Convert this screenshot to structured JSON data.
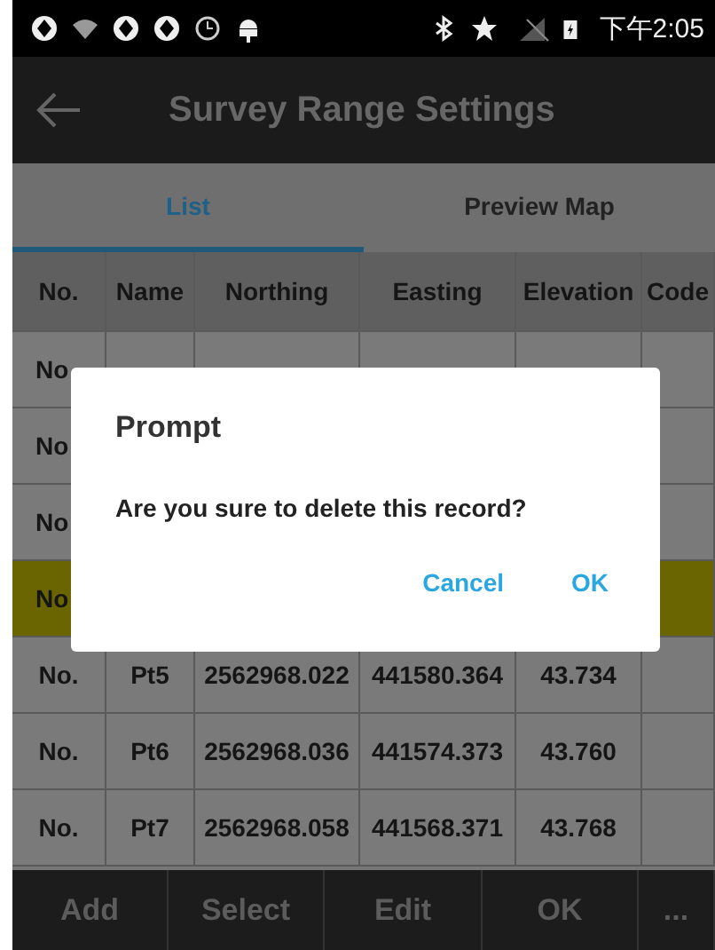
{
  "status_bar": {
    "time": "下午2:05"
  },
  "app_bar": {
    "title": "Survey Range Settings"
  },
  "tabs": [
    {
      "label": "List",
      "selected": true
    },
    {
      "label": "Preview Map",
      "selected": false
    }
  ],
  "table": {
    "columns": [
      "No.",
      "Name",
      "Northing",
      "Easting",
      "Elevation",
      "Code"
    ],
    "rows": [
      {
        "selected": false,
        "cells": [
          "No"
        ]
      },
      {
        "selected": false,
        "cells": [
          "No"
        ]
      },
      {
        "selected": false,
        "cells": [
          "No"
        ]
      },
      {
        "selected": true,
        "cells": [
          "No"
        ]
      },
      {
        "selected": false,
        "cells": [
          "No.",
          "Pt5",
          "2562968.022",
          "441580.364",
          "43.734"
        ]
      },
      {
        "selected": false,
        "cells": [
          "No.",
          "Pt6",
          "2562968.036",
          "441574.373",
          "43.760"
        ]
      },
      {
        "selected": false,
        "cells": [
          "No.",
          "Pt7",
          "2562968.058",
          "441568.371",
          "43.768"
        ]
      }
    ]
  },
  "dialog": {
    "title": "Prompt",
    "message": "Are you sure to delete this record?",
    "buttons": [
      "Cancel",
      "OK"
    ]
  },
  "bottom_bar": [
    "Add",
    "Select",
    "Edit",
    "OK",
    "..."
  ]
}
